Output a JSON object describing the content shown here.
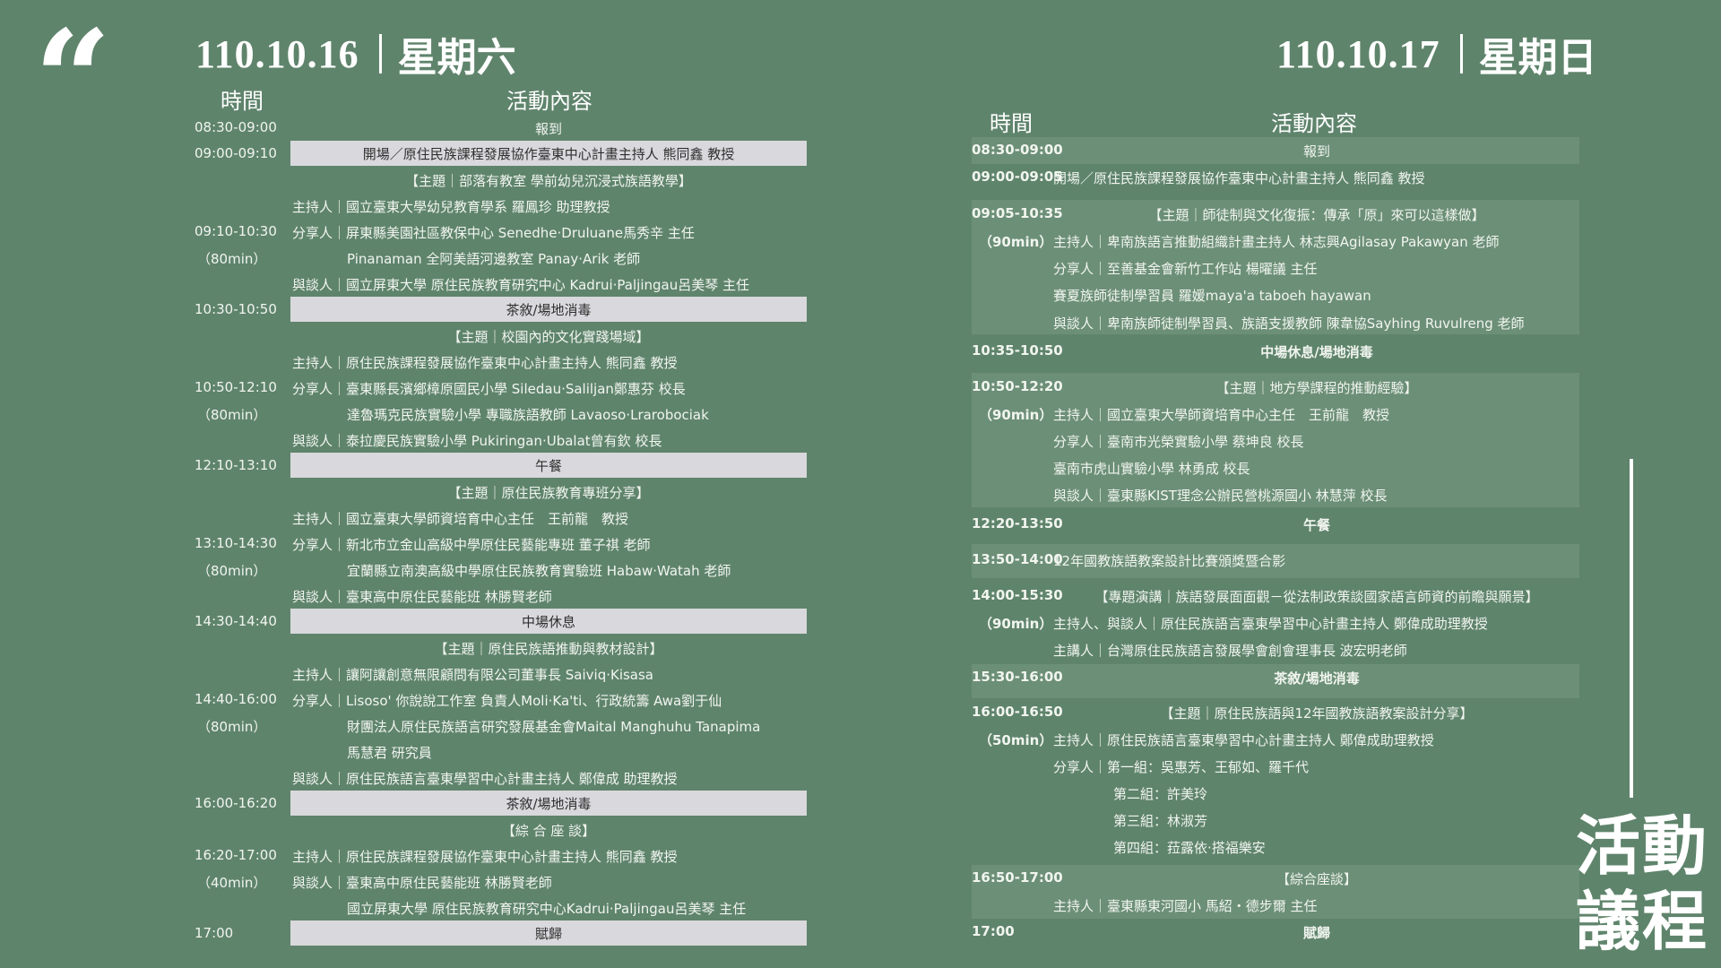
{
  "quote_glyph": "“",
  "day1": {
    "date": "110.10.16",
    "dow": "星期六",
    "col_time": "時間",
    "col_content": "活動內容",
    "rows": [
      {
        "time": "08:30-09:00",
        "text": "報到",
        "kind": "plain-center"
      },
      {
        "time": "09:00-09:10",
        "text": "開場／原住民族課程發展協作臺東中心計畫主持人 熊同鑫 教授",
        "kind": "bar"
      },
      {
        "text": "【主題｜部落有教室 學前幼兒沉浸式族語教學】",
        "kind": "plain-center"
      },
      {
        "text": "主持人｜國立臺東大學幼兒教育學系 羅鳳珍 助理教授",
        "kind": "line"
      },
      {
        "time": "09:10-10:30",
        "text": "分享人｜屏東縣美園社區教保中心 Senedhe·Druluane馬秀辛 主任",
        "kind": "line"
      },
      {
        "time2": "（80min）",
        "text": "Pinanaman 全阿美語河邊教室 Panay·Arik 老師",
        "kind": "indent"
      },
      {
        "text": "與談人｜國立屏東大學 原住民族教育研究中心 Kadrui·Paljingau呂美琴 主任",
        "kind": "line"
      },
      {
        "time": "10:30-10:50",
        "text": "茶敘/場地消毒",
        "kind": "bar"
      },
      {
        "text": "【主題｜校園內的文化實踐場域】",
        "kind": "plain-center"
      },
      {
        "text": "主持人｜原住民族課程發展協作臺東中心計畫主持人 熊同鑫 教授",
        "kind": "line"
      },
      {
        "time": "10:50-12:10",
        "text": "分享人｜臺東縣長濱鄉樟原國民小學 Siledau·Saliljan鄭惠芬 校長",
        "kind": "line"
      },
      {
        "time2": "（80min）",
        "text": "達魯瑪克民族實驗小學 專職族語教師 Lavaoso·Lrarobociak",
        "kind": "indent"
      },
      {
        "text": "與談人｜泰拉慶民族實驗小學 Pukiringan·Ubalat曾有欽 校長",
        "kind": "line"
      },
      {
        "time": "12:10-13:10",
        "text": "午餐",
        "kind": "bar"
      },
      {
        "text": "【主題｜原住民族教育專班分享】",
        "kind": "plain-center"
      },
      {
        "text": "主持人｜國立臺東大學師資培育中心主任　王前龍　教授",
        "kind": "line"
      },
      {
        "time": "13:10-14:30",
        "text": "分享人｜新北市立金山高級中學原住民藝能專班 董子祺 老師",
        "kind": "line"
      },
      {
        "time2": "（80min）",
        "text": "宜蘭縣立南澳高級中學原住民族教育實驗班 Habaw·Watah 老師",
        "kind": "indent"
      },
      {
        "text": "與談人｜臺東高中原住民藝能班 林勝賢老師",
        "kind": "line"
      },
      {
        "time": "14:30-14:40",
        "text": "中場休息",
        "kind": "bar"
      },
      {
        "text": "【主題｜原住民族語推動與教材設計】",
        "kind": "plain-center"
      },
      {
        "text": "主持人｜讓阿讓創意無限顧問有限公司董事長 Saiviq·Kisasa",
        "kind": "line"
      },
      {
        "time": "14:40-16:00",
        "text": "分享人｜Lisoso' 你說說工作室 負責人Moli·Ka'ti、行政統籌 Awa劉于仙",
        "kind": "line"
      },
      {
        "time2": "（80min）",
        "text": "財團法人原住民族語言研究發展基金會Maital Manghuhu Tanapima",
        "kind": "indent"
      },
      {
        "text": "馬慧君 研究員",
        "kind": "indent"
      },
      {
        "text": "與談人｜原住民族語言臺東學習中心計畫主持人 鄭偉成 助理教授",
        "kind": "line"
      },
      {
        "time": "16:00-16:20",
        "text": "茶敘/場地消毒",
        "kind": "bar"
      },
      {
        "text": "【綜 合 座 談】",
        "kind": "plain-center"
      },
      {
        "time": "16:20-17:00",
        "text": "主持人｜原住民族課程發展協作臺東中心計畫主持人 熊同鑫 教授",
        "kind": "line"
      },
      {
        "time2": "（40min）",
        "text": "與談人｜臺東高中原住民藝能班 林勝賢老師",
        "kind": "line"
      },
      {
        "text": "國立屏東大學 原住民族教育研究中心Kadrui·Paljingau呂美琴 主任",
        "kind": "indent"
      },
      {
        "time": "17:00",
        "text": "賦歸",
        "kind": "bar"
      }
    ]
  },
  "day2": {
    "date": "110.10.17",
    "dow": "星期日",
    "col_time": "時間",
    "col_content": "活動內容",
    "lines": [
      {
        "time": "08:30-09:00",
        "text": "報到",
        "align": "center",
        "bold_text": false
      },
      {
        "time": "09:00-09:05",
        "text": "開場／原住民族課程發展協作臺東中心計畫主持人 熊同鑫 教授",
        "align": "left"
      },
      {
        "time": "09:05-10:35",
        "text": "【主題｜師徒制與文化復振：傳承「原」來可以這樣做】",
        "align": "center"
      },
      {
        "time": "（90min）",
        "text": "主持人｜卑南族語言推動組織計畫主持人 林志興Agilasay Pakawyan 老師",
        "align": "left"
      },
      {
        "text": "分享人｜至善基金會新竹工作站 楊曜議 主任",
        "align": "left"
      },
      {
        "text": "賽夏族師徒制學習員 羅媛maya'a taboeh hayawan",
        "align": "left"
      },
      {
        "text": "與談人｜卑南族師徒制學習員、族語支援教師 陳韋協Sayhing Ruvulreng 老師",
        "align": "left"
      },
      {
        "time": "10:35-10:50",
        "text": "中場休息/場地消毒",
        "align": "center",
        "bold_text": true
      },
      {
        "time": "10:50-12:20",
        "text": "【主題｜地方學課程的推動經驗】",
        "align": "center"
      },
      {
        "time": "（90min）",
        "text": "主持人｜國立臺東大學師資培育中心主任　王前龍　教授",
        "align": "left"
      },
      {
        "text": "分享人｜臺南市光榮實驗小學 蔡坤良 校長",
        "align": "left"
      },
      {
        "text": "臺南市虎山實驗小學 林勇成 校長",
        "align": "left"
      },
      {
        "text": "與談人｜臺東縣KIST理念公辦民營桃源國小 林慧萍 校長",
        "align": "left"
      },
      {
        "time": "12:20-13:50",
        "text": "午餐",
        "align": "center",
        "bold_text": true
      },
      {
        "time": "13:50-14:00",
        "text": "12年國教族語教案設計比賽頒獎暨合影",
        "align": "left"
      },
      {
        "time": "14:00-15:30",
        "text": "【專題演講｜族語發展面面觀－從法制政策談國家語言師資的前瞻與願景】",
        "align": "center"
      },
      {
        "time": "（90min）",
        "text": "主持人、與談人｜原住民族語言臺東學習中心計畫主持人 鄭偉成助理教授",
        "align": "left"
      },
      {
        "text": "主講人｜台灣原住民族語言發展學會創會理事長 波宏明老師",
        "align": "left"
      },
      {
        "time": "15:30-16:00",
        "text": "茶敘/場地消毒",
        "align": "center",
        "bold_text": true
      },
      {
        "time": "16:00-16:50",
        "text": "【主題｜原住民族語與12年國教族語教案設計分享】",
        "align": "center"
      },
      {
        "time": "（50min）",
        "text": "主持人｜原住民族語言臺東學習中心計畫主持人 鄭偉成助理教授",
        "align": "left"
      },
      {
        "text": "分享人｜第一組：吳惠芳、王郁如、羅千代",
        "align": "left"
      },
      {
        "text": "第二組：許美玲",
        "align": "left"
      },
      {
        "text": "第三組：林淑芳",
        "align": "left"
      },
      {
        "text": "第四組：菈露依·搭福樂安",
        "align": "left"
      },
      {
        "time": "16:50-17:00",
        "text": "【綜合座談】",
        "align": "center"
      },
      {
        "text": "主持人｜臺東縣東河國小 馬紹・德步爾 主任",
        "align": "left"
      },
      {
        "time": "17:00",
        "text": "賦歸",
        "align": "center",
        "bold_text": true
      }
    ]
  },
  "side_title": {
    "line1": "活動",
    "line2": "議程"
  }
}
